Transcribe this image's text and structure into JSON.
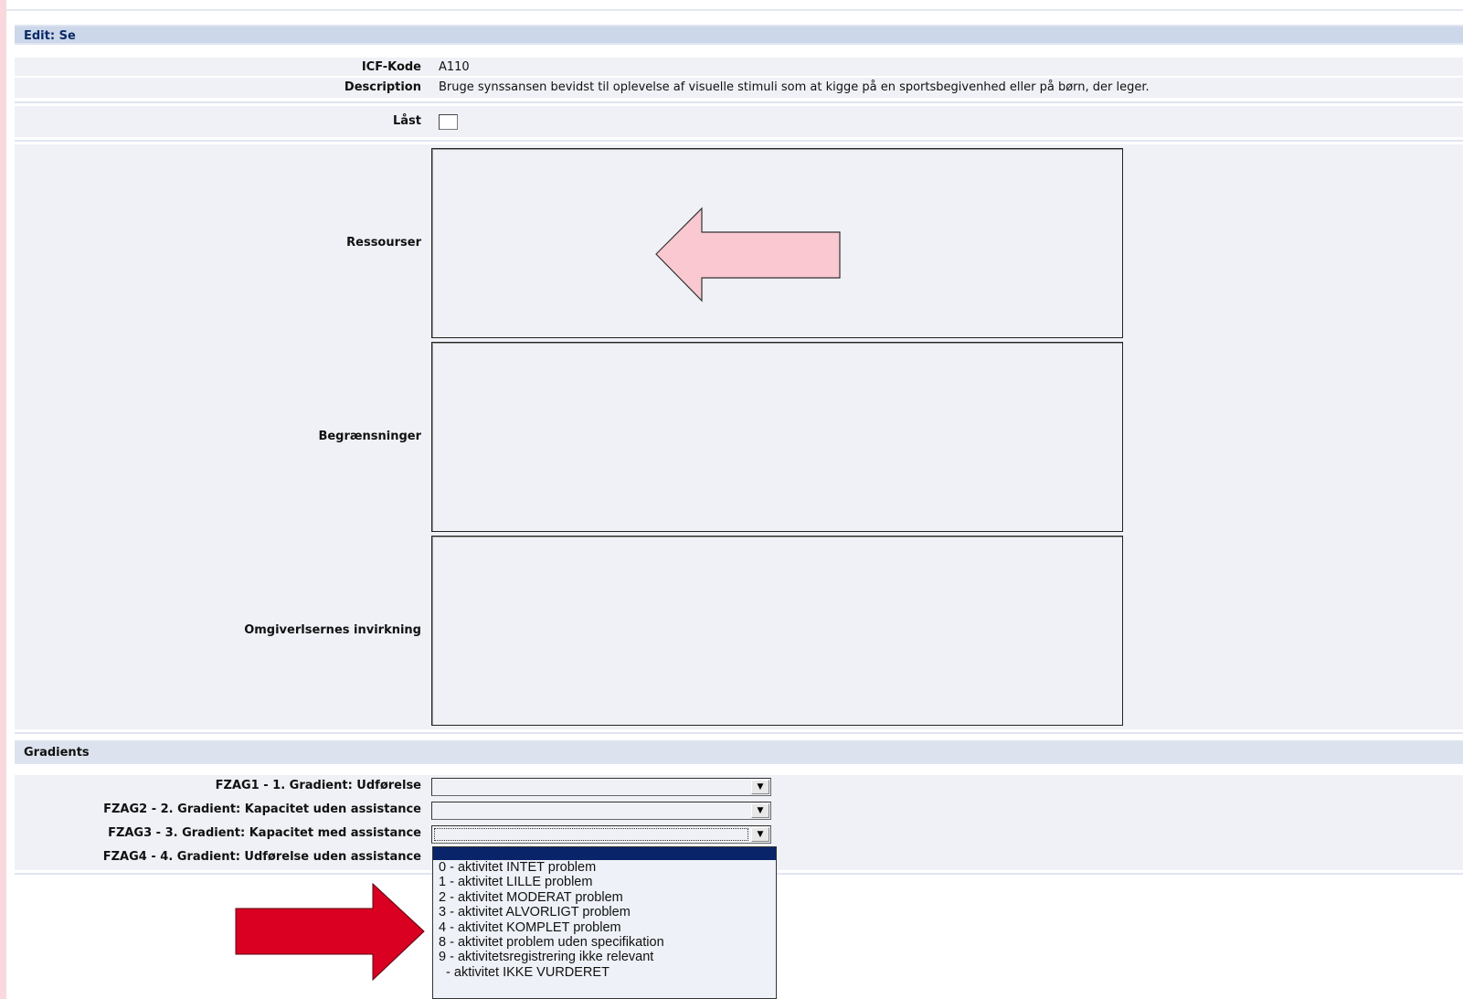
{
  "edit_header": "Edit: Se",
  "fields": {
    "icf_label": "ICF-Kode",
    "icf_value": "A110",
    "description_label": "Description",
    "description_value": "Bruge synssansen bevidst til oplevelse af visuelle stimuli som at kigge på en sportsbegivenhed eller på børn, der leger.",
    "locked_label": "Låst",
    "resources_label": "Ressourser",
    "limitations_label": "Begrænsninger",
    "environment_label": "Omgiverlsernes invirkning"
  },
  "gradients": {
    "header": "Gradients",
    "items": [
      {
        "label": "FZAG1 - 1. Gradient: Udførelse",
        "value": ""
      },
      {
        "label": "FZAG2 - 2. Gradient: Kapacitet uden assistance",
        "value": ""
      },
      {
        "label": "FZAG3 - 3. Gradient: Kapacitet med assistance",
        "value": ""
      },
      {
        "label": "FZAG4 - 4. Gradient: Udførelse uden assistance",
        "value": ""
      }
    ],
    "dropdown_options": [
      "0 - aktivitet INTET problem",
      "1 - aktivitet LILLE problem",
      "2 - aktivitet MODERAT problem",
      "3 - aktivitet ALVORLIGT problem",
      "4 - aktivitet KOMPLET problem",
      "8 - aktivitet problem uden specifikation",
      "9 - aktivitetsregistrering ikke relevant",
      "  - aktivitet IKKE VURDERET"
    ]
  },
  "annotation_colors": {
    "pink_arrow": "#f9c8d0",
    "red_arrow": "#d90022"
  }
}
